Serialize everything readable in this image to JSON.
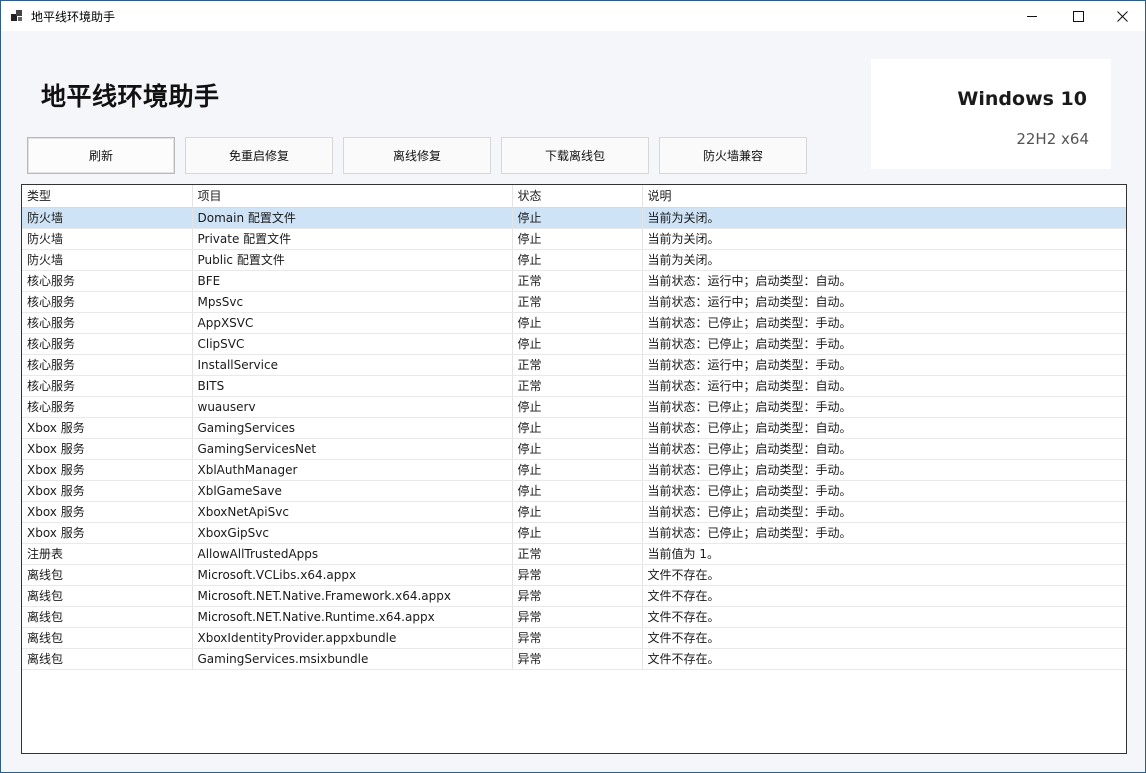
{
  "window": {
    "title": "地平线环境助手"
  },
  "header": {
    "title": "地平线环境助手"
  },
  "os_info": {
    "name": "Windows 10",
    "version": "22H2 x64"
  },
  "toolbar": {
    "buttons": [
      {
        "label": "刷新"
      },
      {
        "label": "免重启修复"
      },
      {
        "label": "离线修复"
      },
      {
        "label": "下载离线包"
      },
      {
        "label": "防火墙兼容"
      }
    ]
  },
  "colors": {
    "status_ok": "#1e9b47",
    "status_stopped": "#c0681a",
    "status_error": "#d42a2a",
    "selection": "#cfe3f7"
  },
  "table": {
    "columns": [
      "类型",
      "项目",
      "状态",
      "说明"
    ],
    "rows": [
      {
        "type": "防火墙",
        "item": "Domain 配置文件",
        "status": "停止",
        "status_kind": "stopped-selected",
        "desc": "当前为关闭。"
      },
      {
        "type": "防火墙",
        "item": "Private 配置文件",
        "status": "停止",
        "status_kind": "stopped",
        "desc": "当前为关闭。"
      },
      {
        "type": "防火墙",
        "item": "Public 配置文件",
        "status": "停止",
        "status_kind": "stopped",
        "desc": "当前为关闭。"
      },
      {
        "type": "核心服务",
        "item": "BFE",
        "status": "正常",
        "status_kind": "ok",
        "desc": "当前状态：运行中；启动类型：自动。"
      },
      {
        "type": "核心服务",
        "item": "MpsSvc",
        "status": "正常",
        "status_kind": "ok",
        "desc": "当前状态：运行中；启动类型：自动。"
      },
      {
        "type": "核心服务",
        "item": "AppXSVC",
        "status": "停止",
        "status_kind": "stopped",
        "desc": "当前状态：已停止；启动类型：手动。"
      },
      {
        "type": "核心服务",
        "item": "ClipSVC",
        "status": "停止",
        "status_kind": "stopped",
        "desc": "当前状态：已停止；启动类型：手动。"
      },
      {
        "type": "核心服务",
        "item": "InstallService",
        "status": "正常",
        "status_kind": "ok",
        "desc": "当前状态：运行中；启动类型：手动。"
      },
      {
        "type": "核心服务",
        "item": "BITS",
        "status": "正常",
        "status_kind": "ok",
        "desc": "当前状态：运行中；启动类型：自动。"
      },
      {
        "type": "核心服务",
        "item": "wuauserv",
        "status": "停止",
        "status_kind": "stopped",
        "desc": "当前状态：已停止；启动类型：手动。"
      },
      {
        "type": "Xbox 服务",
        "item": "GamingServices",
        "status": "停止",
        "status_kind": "stopped",
        "desc": "当前状态：已停止；启动类型：自动。"
      },
      {
        "type": "Xbox 服务",
        "item": "GamingServicesNet",
        "status": "停止",
        "status_kind": "stopped",
        "desc": "当前状态：已停止；启动类型：自动。"
      },
      {
        "type": "Xbox 服务",
        "item": "XblAuthManager",
        "status": "停止",
        "status_kind": "stopped",
        "desc": "当前状态：已停止；启动类型：手动。"
      },
      {
        "type": "Xbox 服务",
        "item": "XblGameSave",
        "status": "停止",
        "status_kind": "stopped",
        "desc": "当前状态：已停止；启动类型：手动。"
      },
      {
        "type": "Xbox 服务",
        "item": "XboxNetApiSvc",
        "status": "停止",
        "status_kind": "stopped",
        "desc": "当前状态：已停止；启动类型：手动。"
      },
      {
        "type": "Xbox 服务",
        "item": "XboxGipSvc",
        "status": "停止",
        "status_kind": "stopped",
        "desc": "当前状态：已停止；启动类型：手动。"
      },
      {
        "type": "注册表",
        "item": "AllowAllTrustedApps",
        "status": "正常",
        "status_kind": "ok",
        "desc": "当前值为 1。"
      },
      {
        "type": "离线包",
        "item": "Microsoft.VCLibs.x64.appx",
        "status": "异常",
        "status_kind": "error",
        "desc": "文件不存在。"
      },
      {
        "type": "离线包",
        "item": "Microsoft.NET.Native.Framework.x64.appx",
        "status": "异常",
        "status_kind": "error",
        "desc": "文件不存在。"
      },
      {
        "type": "离线包",
        "item": "Microsoft.NET.Native.Runtime.x64.appx",
        "status": "异常",
        "status_kind": "error",
        "desc": "文件不存在。"
      },
      {
        "type": "离线包",
        "item": "XboxIdentityProvider.appxbundle",
        "status": "异常",
        "status_kind": "error",
        "desc": "文件不存在。"
      },
      {
        "type": "离线包",
        "item": "GamingServices.msixbundle",
        "status": "异常",
        "status_kind": "error",
        "desc": "文件不存在。"
      }
    ]
  }
}
